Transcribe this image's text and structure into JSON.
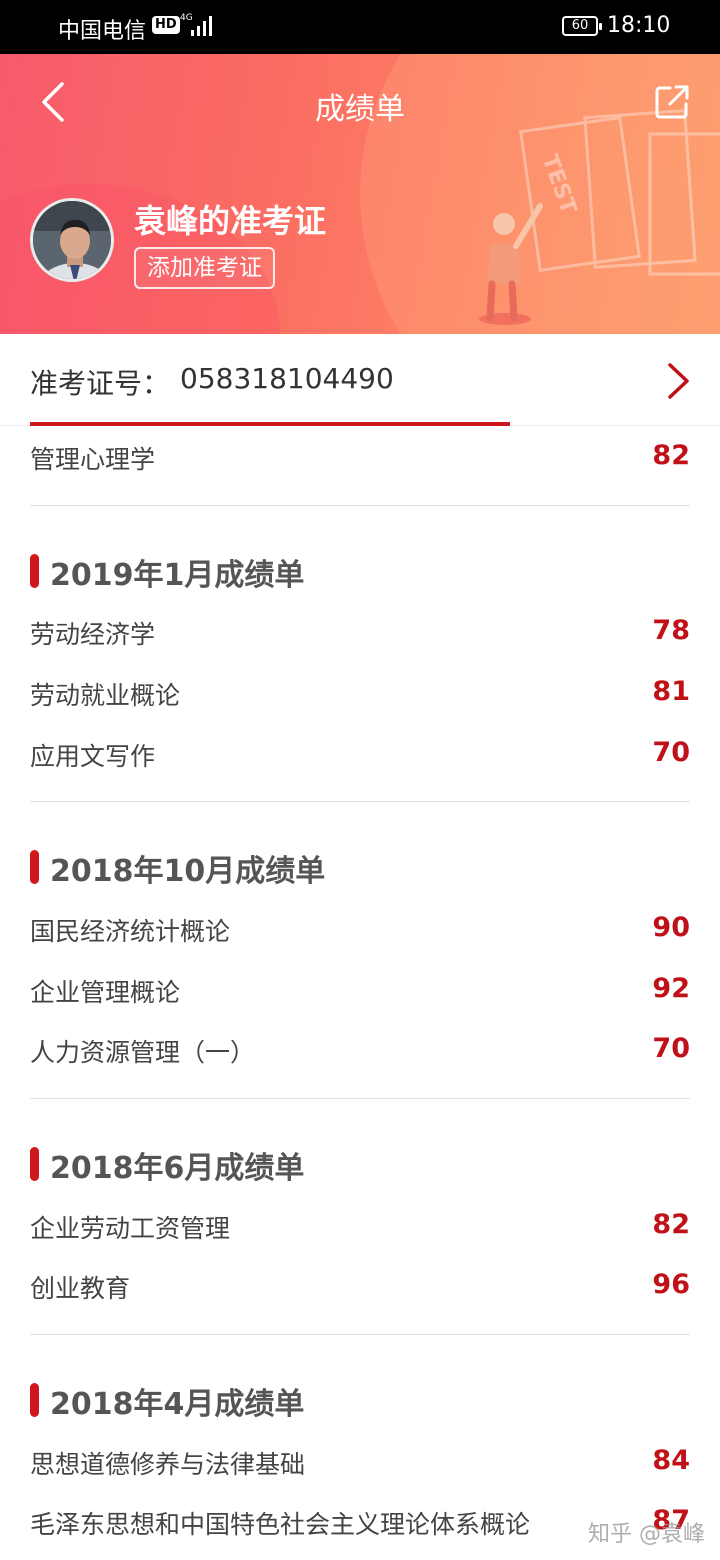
{
  "status_bar": {
    "carrier": "中国电信",
    "hd": "HD",
    "network": "4G",
    "battery": "60",
    "time": "18:10"
  },
  "header": {
    "title": "成绩单",
    "back_icon": "chevron-left-icon",
    "share_icon": "share-icon"
  },
  "profile": {
    "name": "袁峰的准考证",
    "add_button": "添加准考证"
  },
  "ticket": {
    "label": "准考证号：",
    "number": "058318104490"
  },
  "prev_item": {
    "subject": "管理心理学",
    "score": "82"
  },
  "sections": [
    {
      "title": "2019年1月成绩单",
      "items": [
        {
          "subject": "劳动经济学",
          "score": "78"
        },
        {
          "subject": "劳动就业概论",
          "score": "81"
        },
        {
          "subject": "应用文写作",
          "score": "70"
        }
      ]
    },
    {
      "title": "2018年10月成绩单",
      "items": [
        {
          "subject": "国民经济统计概论",
          "score": "90"
        },
        {
          "subject": "企业管理概论",
          "score": "92"
        },
        {
          "subject": "人力资源管理（一）",
          "score": "70"
        }
      ]
    },
    {
      "title": "2018年6月成绩单",
      "items": [
        {
          "subject": "企业劳动工资管理",
          "score": "82"
        },
        {
          "subject": "创业教育",
          "score": "96"
        }
      ]
    },
    {
      "title": "2018年4月成绩单",
      "items": [
        {
          "subject": "思想道德修养与法律基础",
          "score": "84"
        },
        {
          "subject": "毛泽东思想和中国特色社会主义理论体系概论",
          "score": "87"
        }
      ]
    }
  ],
  "watermark": "知乎 @袁峰",
  "colors": {
    "accent": "#d0171d",
    "score": "#c01118",
    "hero_start": "#f75a6c",
    "hero_end": "#fd9a6a"
  }
}
